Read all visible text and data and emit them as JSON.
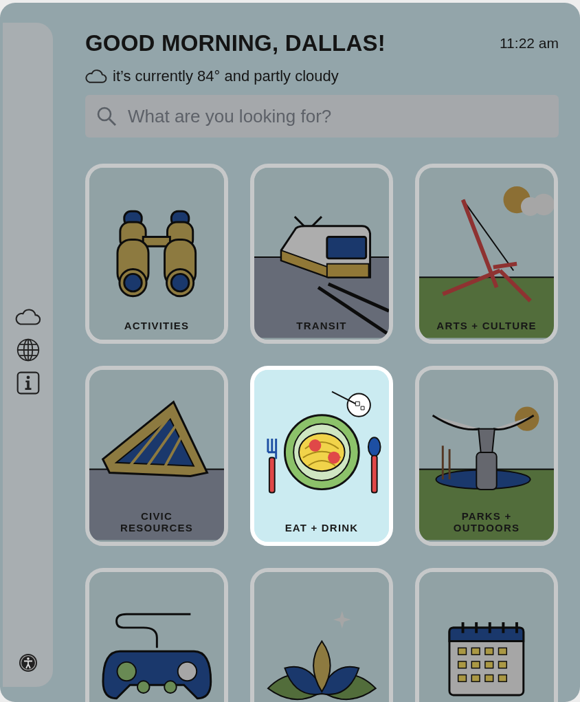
{
  "greeting": "GOOD MORNING, DALLAS!",
  "time": "11:22 am",
  "weather": {
    "text": "it’s currently 84° and partly cloudy"
  },
  "search": {
    "placeholder": "What are you looking for?"
  },
  "sidebar": {
    "items": [
      {
        "kind": "weather"
      },
      {
        "kind": "language"
      },
      {
        "kind": "info"
      }
    ],
    "footer": {
      "kind": "accessibility"
    }
  },
  "tiles": [
    {
      "kind": "binoculars",
      "label": "ACTIVITIES",
      "selected": false
    },
    {
      "kind": "train",
      "label": "TRANSIT",
      "selected": false
    },
    {
      "kind": "sculpture",
      "label": "ARTS + CULTURE",
      "selected": false
    },
    {
      "kind": "building",
      "label": "CIVIC\nRESOURCES",
      "selected": false
    },
    {
      "kind": "food",
      "label": "EAT + DRINK",
      "selected": true
    },
    {
      "kind": "longhorn",
      "label": "PARKS +\nOUTDOORS",
      "selected": false
    },
    {
      "kind": "controller",
      "selected": false
    },
    {
      "kind": "lotus",
      "selected": false
    },
    {
      "kind": "calendar",
      "selected": false
    }
  ]
}
